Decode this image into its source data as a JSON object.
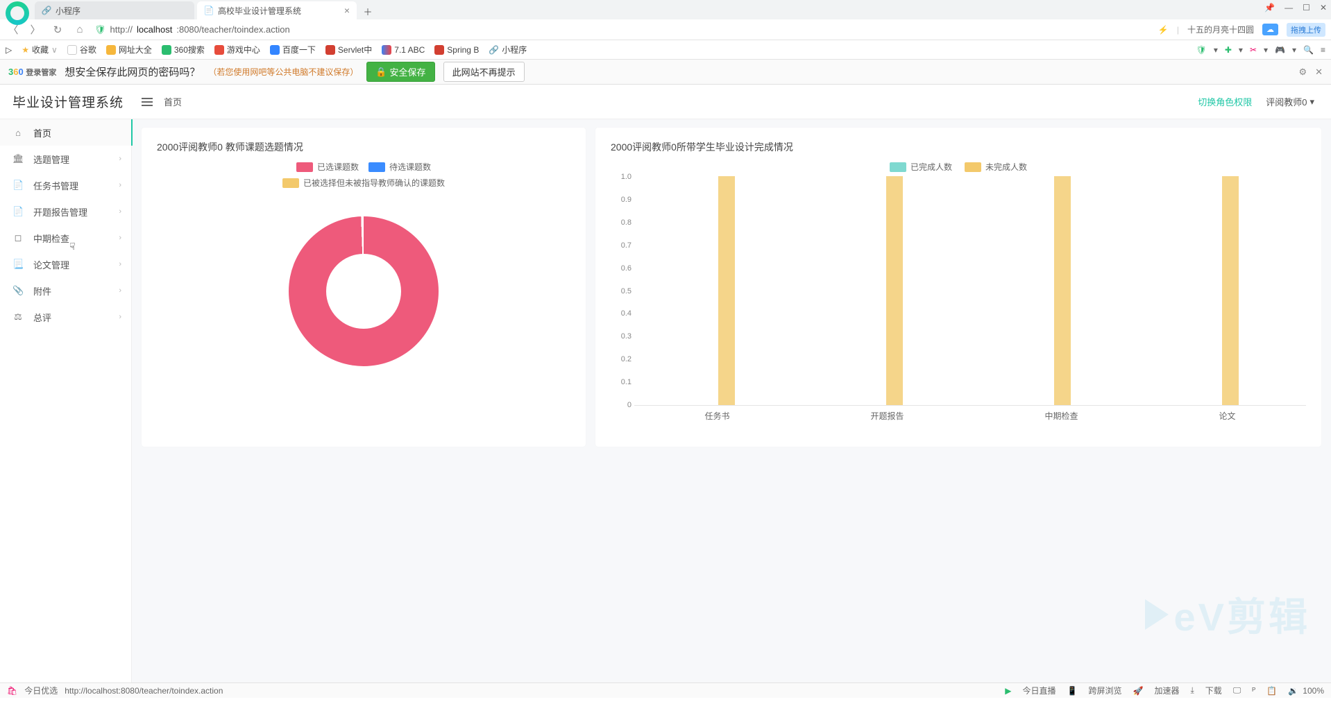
{
  "browser": {
    "tabs": [
      {
        "icon": "📄",
        "label": "小程序"
      },
      {
        "icon": "📄",
        "label": "高校毕业设计管理系统"
      }
    ],
    "win_tooltip": "拖拽上传",
    "url_display": {
      "pre": "http://",
      "host": "localhost",
      "rest": ":8080/teacher/toindex.action"
    },
    "addr_flash": "⚡",
    "addr_sep": "|",
    "addr_moon": "十五的月亮十四圆",
    "bookmarks": [
      "收藏",
      "谷歌",
      "网址大全",
      "360搜索",
      "游戏中心",
      "百度一下",
      "Servlet中",
      "7.1 ABC",
      "Spring B",
      "小程序"
    ],
    "save": {
      "q": "想安全保存此网页的密码吗？",
      "hint": "（若您使用网吧等公共电脑不建议保存）",
      "btn_save": "安全保存",
      "btn_never": "此网站不再提示",
      "brand": "登录管家"
    }
  },
  "app": {
    "brand": "毕业设计管理系统",
    "breadcrumb": "首页",
    "role_link": "切换角色权限",
    "user": "评阅教师0"
  },
  "sidebar": {
    "items": [
      {
        "icon": "⌂",
        "label": "首页",
        "expandable": false,
        "active": true
      },
      {
        "icon": "🏛",
        "label": "选题管理",
        "expandable": true
      },
      {
        "icon": "📄",
        "label": "任务书管理",
        "expandable": true
      },
      {
        "icon": "📄",
        "label": "开题报告管理",
        "expandable": true
      },
      {
        "icon": "◻",
        "label": "中期检查",
        "expandable": true
      },
      {
        "icon": "📃",
        "label": "论文管理",
        "expandable": true
      },
      {
        "icon": "📎",
        "label": "附件",
        "expandable": true
      },
      {
        "icon": "⚖",
        "label": "总评",
        "expandable": true
      }
    ]
  },
  "cards": {
    "left_title": "2000评阅教师0 教师课题选题情况",
    "right_title": "2000评阅教师0所带学生毕业设计完成情况"
  },
  "chart_data": [
    {
      "type": "pie",
      "title": "2000评阅教师0 教师课题选题情况",
      "series": [
        {
          "name": "已选课题数",
          "value": 1,
          "color": "#ee5a7b"
        },
        {
          "name": "待选课题数",
          "value": 0,
          "color": "#3a8cff"
        },
        {
          "name": "已被选择但未被指导教师确认的课题数",
          "value": 0,
          "color": "#f3c96b"
        }
      ],
      "legend_position": "top",
      "inner_radius": 0.5
    },
    {
      "type": "bar",
      "title": "2000评阅教师0所带学生毕业设计完成情况",
      "categories": [
        "任务书",
        "开题报告",
        "中期检查",
        "论文"
      ],
      "series": [
        {
          "name": "已完成人数",
          "color": "#7fd9d0",
          "values": [
            0,
            0,
            0,
            0
          ]
        },
        {
          "name": "未完成人数",
          "color": "#f3c96b",
          "values": [
            1,
            1,
            1,
            1
          ]
        }
      ],
      "ylim": [
        0,
        1
      ],
      "yticks": [
        0,
        0.1,
        0.2,
        0.3,
        0.4,
        0.5,
        0.6,
        0.7,
        0.8,
        0.9,
        1.0
      ],
      "xlabel": "",
      "ylabel": "",
      "grid": false,
      "legend_position": "top"
    }
  ],
  "status": {
    "left_icon": "🛍",
    "left_label": "今日优选",
    "url": "http://localhost:8080/teacher/toindex.action",
    "items": [
      "今日直播",
      "跨屏浏览",
      "加速器",
      "下载",
      "🖵",
      "ᴾ",
      "📋"
    ],
    "zoom_label": "100%",
    "speaker": "🔉"
  },
  "watermark": "eV剪辑"
}
